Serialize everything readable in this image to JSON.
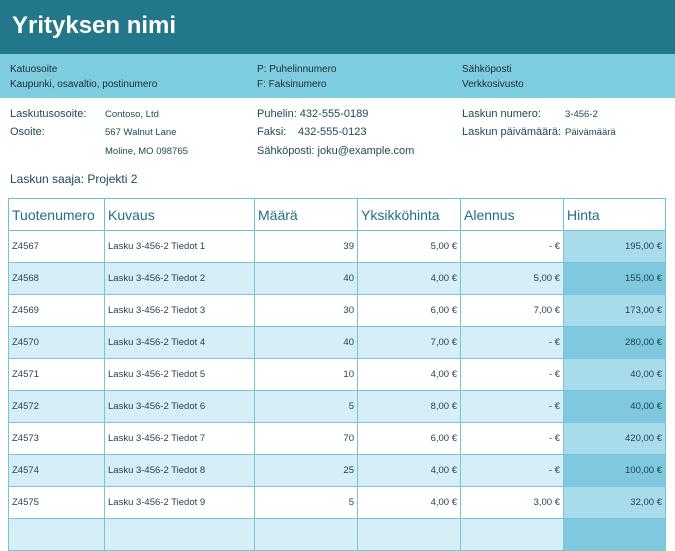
{
  "company": {
    "name": "Yrityksen nimi",
    "street": "Katuosoite",
    "city_line": "Kaupunki, osavaltio, postinumero",
    "phone": "P: Puhelinnumero",
    "fax": "F: Faksinumero",
    "email_label": "Sähköposti",
    "website": "Verkkosivusto"
  },
  "billing": {
    "address_label": "Laskutusosoite:",
    "address_value": "Contoso, Ltd",
    "street_label": "Osoite:",
    "street_value": "567 Walnut Lane",
    "city_value": "Moline, MO 098765",
    "phone": "Puhelin: 432-555-0189",
    "fax_label": "Faksi:",
    "fax_value": "432-555-0123",
    "email": "Sähköposti: joku@example.com",
    "invoice_no_label": "Laskun numero:",
    "invoice_no_value": "3-456-2",
    "invoice_date_label": "Laskun päivämäärä:",
    "invoice_date_value": "Päivämäärä"
  },
  "recipient": "Laskun saaja: Projekti 2",
  "table": {
    "headers": [
      "Tuotenumero",
      "Kuvaus",
      "Määrä",
      "Yksikköhinta",
      "Alennus",
      "Hinta"
    ],
    "rows": [
      [
        "Z4567",
        "Lasku 3-456-2 Tiedot 1",
        "39",
        "5,00 €",
        "-   €",
        "195,00 €"
      ],
      [
        "Z4568",
        "Lasku 3-456-2 Tiedot 2",
        "40",
        "4,00 €",
        "5,00 €",
        "155,00 €"
      ],
      [
        "Z4569",
        "Lasku 3-456-2 Tiedot 3",
        "30",
        "6,00 €",
        "7,00 €",
        "173,00 €"
      ],
      [
        "Z4570",
        "Lasku 3-456-2 Tiedot 4",
        "40",
        "7,00 €",
        "-   €",
        "280,00 €"
      ],
      [
        "Z4571",
        "Lasku 3-456-2 Tiedot 5",
        "10",
        "4,00 €",
        "-   €",
        "40,00 €"
      ],
      [
        "Z4572",
        "Lasku 3-456-2 Tiedot 6",
        "5",
        "8,00 €",
        "-   €",
        "40,00 €"
      ],
      [
        "Z4573",
        "Lasku 3-456-2 Tiedot 7",
        "70",
        "6,00 €",
        "-   €",
        "420,00 €"
      ],
      [
        "Z4574",
        "Lasku 3-456-2 Tiedot 8",
        "25",
        "4,00 €",
        "-   €",
        "100,00 €"
      ],
      [
        "Z4575",
        "Lasku 3-456-2 Tiedot 9",
        "5",
        "4,00 €",
        "3,00 €",
        "32,00 €"
      ],
      [
        "",
        "",
        "",
        "",
        "",
        ""
      ]
    ]
  }
}
